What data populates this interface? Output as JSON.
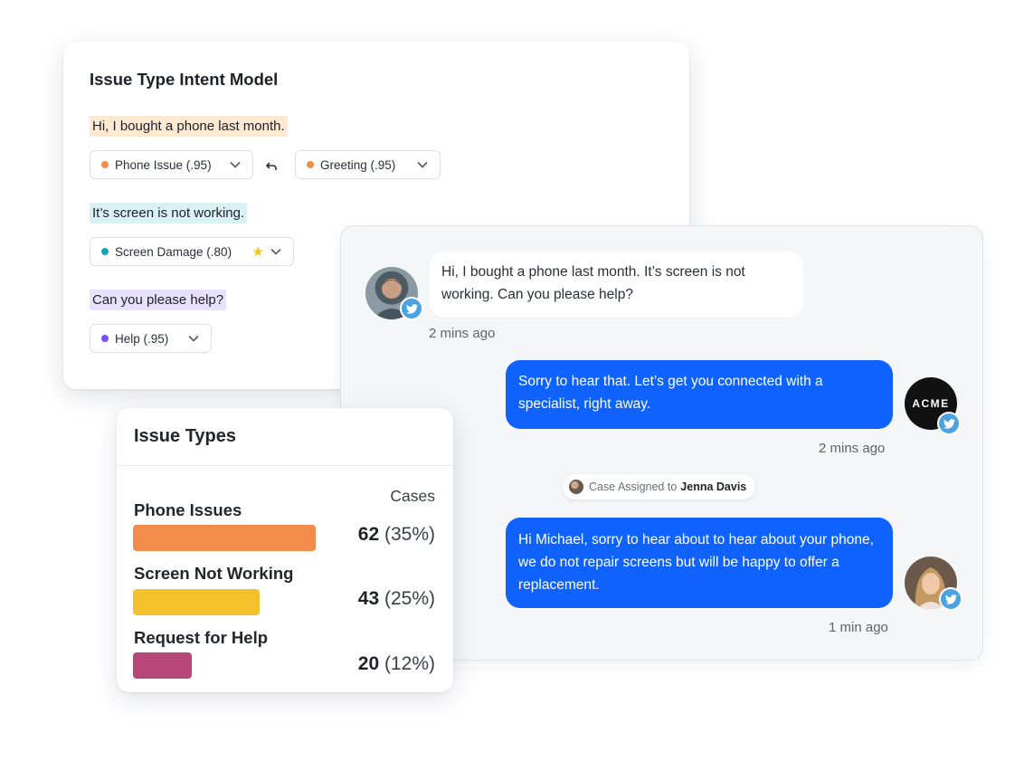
{
  "intent_model": {
    "title": "Issue Type Intent Model",
    "utterances": [
      {
        "text": "Hi, I bought a phone last month.",
        "chips": [
          {
            "label": "Phone Issue (.95)",
            "dot_color": "#f28c4a"
          },
          {
            "label": "Greeting (.95)",
            "dot_color": "#f28c4a"
          }
        ],
        "undo_icon": "undo-icon"
      },
      {
        "text": "It’s screen is not working.",
        "chips": [
          {
            "label": "Screen Damage (.80)",
            "dot_color": "#17a2b8",
            "starred": true
          }
        ]
      },
      {
        "text": "Can you please help?",
        "chips": [
          {
            "label": "Help (.95)",
            "dot_color": "#7b4dff"
          }
        ]
      }
    ],
    "highlight_colors": [
      "#fde9d2",
      "#d9f1f5",
      "#e7e1fb"
    ]
  },
  "chat": {
    "messages": [
      {
        "direction": "incoming",
        "text": "Hi, I bought a phone last month. It’s screen is not working. Can you please help?",
        "time": "2 mins ago",
        "avatar": "customer-avatar",
        "badge": "twitter-icon"
      },
      {
        "direction": "outgoing",
        "text": "Sorry to hear that. Let’s get you connected with a specialist, right away.",
        "time": "2 mins ago",
        "avatar": "acme-logo",
        "avatar_text": "ACME",
        "badge": "twitter-icon"
      },
      {
        "direction": "outgoing",
        "text": "Hi Michael,  sorry to hear about to hear about your phone, we do not repair screens but will be happy to offer a replacement.",
        "time": "1 min ago",
        "avatar": "agent-avatar",
        "badge": "twitter-icon"
      }
    ],
    "assignment": {
      "prefix": "Case Assigned to",
      "assignee": "Jenna Davis"
    },
    "colors": {
      "outgoing_bubble": "#0f62fe",
      "incoming_bubble": "#ffffff",
      "badge": "#4aa3df"
    }
  },
  "issue_types": {
    "title": "Issue Types",
    "cases_header": "Cases",
    "chart_data": {
      "type": "bar",
      "categories": [
        "Phone Issues",
        "Screen Not Working",
        "Request for Help"
      ],
      "values": [
        62,
        43,
        20
      ],
      "percent_labels": [
        "(35%)",
        "(25%)",
        "(12%)"
      ],
      "colors": [
        "#f28c4a",
        "#f3c12b",
        "#b8487a"
      ],
      "count_labels": [
        "62",
        "43",
        "20"
      ]
    }
  }
}
